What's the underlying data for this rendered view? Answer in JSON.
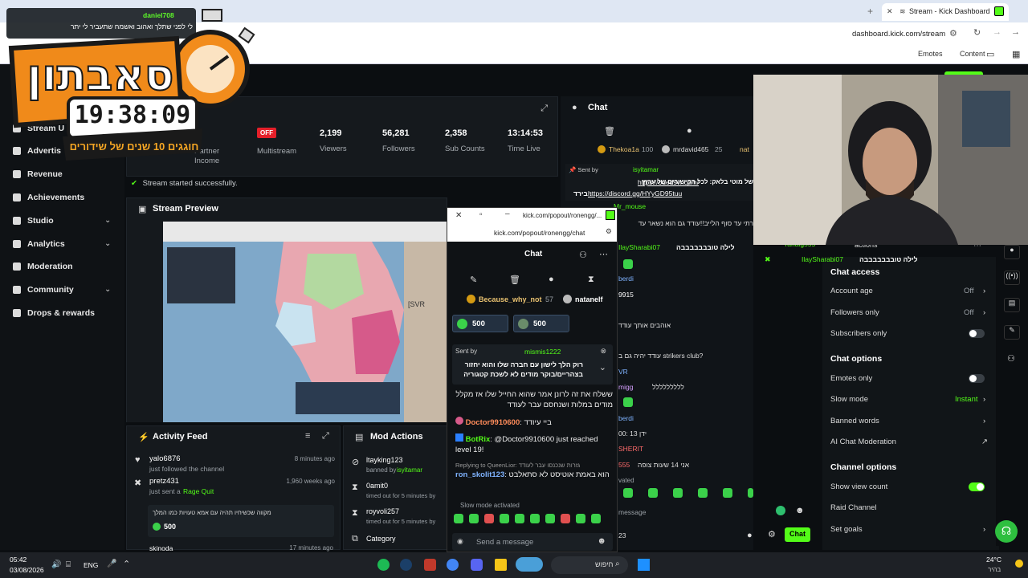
{
  "browser": {
    "tab_title": "Stream - Kick Dashboard",
    "url": "dashboard.kick.com/stream",
    "bookmarks": [
      "Emotes",
      "Content"
    ],
    "overlay_user": "daniel708",
    "overlay_rtl_text": "לי לפני שתלך ואהוב ואשמח שתעביר לי יתר",
    "colors": {
      "kick_green": "#53fc18",
      "panel": "#15191d"
    }
  },
  "sidebar": {
    "items": [
      {
        "label": "Stream U",
        "icon": "broadcast-icon"
      },
      {
        "label": "Advertis",
        "icon": "megaphone-icon"
      },
      {
        "label": "Revenue",
        "icon": "dollar-icon"
      },
      {
        "label": "Achievements",
        "icon": "trophy-icon"
      },
      {
        "label": "Studio",
        "icon": "studio-icon",
        "chevron": true
      },
      {
        "label": "Analytics",
        "icon": "chart-icon",
        "chevron": true
      },
      {
        "label": "Moderation",
        "icon": "wrench-icon"
      },
      {
        "label": "Community",
        "icon": "people-icon",
        "chevron": true
      },
      {
        "label": "Drops & rewards",
        "icon": "gift-icon"
      }
    ]
  },
  "stats": {
    "partner_income_label": "Partner\nIncome",
    "multistream_badge": "OFF",
    "multistream_label": "Multistream",
    "viewers_value": "2,199",
    "viewers_label": "Viewers",
    "followers_value": "56,281",
    "followers_label": "Followers",
    "subs_value": "2,358",
    "subs_label": "Sub Counts",
    "time_value": "13:14:53",
    "time_label": "Time Live",
    "session_label": "ssion"
  },
  "toast": "Stream started successfully.",
  "preview": {
    "title": "Stream Preview"
  },
  "activity": {
    "title": "Activity Feed",
    "items": [
      {
        "user": "yalo6876",
        "action": "just followed the channel",
        "time": "8 minutes ago"
      },
      {
        "user": "pretz431",
        "action": "just sent a",
        "highlight": "Rage Quit",
        "time": "1,960 weeks ago",
        "message": "מקווה שכשיחיו תהיה עם אמא טעויות כמו המלך",
        "amount": "500"
      },
      {
        "user": "skinoda",
        "time": "17 minutes ago"
      }
    ]
  },
  "modactions": {
    "title": "Mod Actions",
    "items": [
      {
        "user": "ltayking123",
        "line2": "banned by",
        "by": "isyitamar"
      },
      {
        "user": "0amit0",
        "line2": "timed out for 5 minutes by",
        "by": "Sa"
      },
      {
        "user": "royvoli257",
        "line2": "timed out for 5 minutes by",
        "by": "ele"
      },
      {
        "user": "Category",
        "line2": ""
      }
    ]
  },
  "popout": {
    "title_url": "kick.com/popout/ronengg/...",
    "url": "kick.com/popout/ronengg/chat",
    "chat_title": "Chat",
    "top_users": [
      {
        "name": "Because_why_not",
        "count": "57"
      },
      {
        "name": "natanelf"
      }
    ],
    "gift_amounts": [
      "500",
      "500"
    ],
    "pinned_by": "Sent by",
    "pinned_user": "mismis1222",
    "pinned_text": "רוק הלך לישון עם חברה שלו והוא יחזור בצהריים/בוקר מודים לא לשכת קטגוריה",
    "messages": [
      {
        "user": "",
        "text": "ששלח את זה לרונן אמר שהוא החייל שלו אז מקלל מודים במלות ושנחסם עבר לעודד"
      },
      {
        "user": "Doctor9910600",
        "text": "ביי עיודד"
      },
      {
        "user": "BotRix",
        "text": "@Doctor9910600 just reached level 19!"
      },
      {
        "user": "ron_skolit123",
        "reply": "Replying to QueenLior: גזרות שנכנסו עבר לעודד",
        "text": "הוא באמת אוטיסט לא סתאלבט"
      }
    ],
    "slow_mode": "Slow mode activated",
    "send_placeholder": "Send a message"
  },
  "chat": {
    "title": "Chat",
    "top_users": [
      {
        "name": "Thekoa1a",
        "count": "100"
      },
      {
        "name": "mrdavid465",
        "count": "25"
      },
      {
        "name": "nat"
      }
    ],
    "pinned_user": "isyitamar",
    "pinned_text": "של מוטי בלאק: לכל הקישורים של ערוץ",
    "link1": "https://odedsvr.com/",
    "link2": "https://discord.gg/HYyGD95tuu",
    "link2_prefix": "בירד :",
    "lines": [
      {
        "u": "Mr_mouse",
        "t": ""
      },
      {
        "u": "",
        "t": "רתי עד סוף הלייב!!עודד גם הוא נשאר עד"
      },
      {
        "u": "IlaySharabi07",
        "t": "לילה טובבבבבבבה"
      },
      {
        "u": "berdi",
        "t": ""
      },
      {
        "u": "9915",
        "t": ""
      },
      {
        "u": "",
        "t": "אוהבים אותך עודד"
      },
      {
        "u": "",
        "t": "עודד יהיה גם ב strikers club?"
      },
      {
        "u": "VR",
        "t": ""
      },
      {
        "u": "migg",
        "t": "ללללללללל"
      },
      {
        "u": "berdi",
        "t": ""
      },
      {
        "u": "",
        "t": "00: 13 ידן"
      },
      {
        "u": "SHERIT",
        "t": ""
      },
      {
        "u": "555",
        "t": "אני 14 שעות צופה"
      }
    ],
    "over_users": [
      "Tanaig555",
      "IlaySharabi07"
    ],
    "over_text": "לילה טובבבבבבבה",
    "actions_label": "actions",
    "activated": "vated",
    "send_placeholder": "message",
    "count": "23",
    "chat_button": "Chat"
  },
  "settings": {
    "access_title": "Chat access",
    "account_age": "Account age",
    "account_age_val": "Off",
    "followers_only": "Followers only",
    "followers_only_val": "Off",
    "subscribers_only": "Subscribers only",
    "options_title": "Chat options",
    "emotes_only": "Emotes only",
    "slow_mode": "Slow mode",
    "slow_mode_val": "Instant",
    "banned_words": "Banned words",
    "ai_moderation": "AI Chat Moderation",
    "channel_title": "Channel options",
    "show_view_count": "Show view count",
    "raid_channel": "Raid Channel",
    "set_goals": "Set goals"
  },
  "overlay": {
    "title": "סאבתון",
    "timer": "19:38:09",
    "subtitle": "חוגגים 10 שנים של שידורים"
  },
  "taskbar": {
    "time": "05:42",
    "date": "03/08/2026",
    "lang": "ENG",
    "search": "חיפוש",
    "temp": "24°C",
    "weather": "בהיר"
  }
}
